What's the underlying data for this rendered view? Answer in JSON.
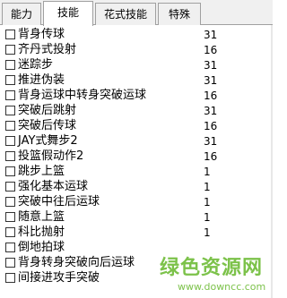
{
  "tabs": [
    {
      "label": "能力",
      "active": false
    },
    {
      "label": "技能",
      "active": true
    },
    {
      "label": "花式技能",
      "active": false
    },
    {
      "label": "特殊",
      "active": false
    }
  ],
  "skills": [
    {
      "name": "背身传球",
      "count": "31"
    },
    {
      "name": "齐丹式投射",
      "count": "16"
    },
    {
      "name": "迷踪步",
      "count": "31"
    },
    {
      "name": "推进伪装",
      "count": "31"
    },
    {
      "name": "背身运球中转身突破运球",
      "count": "16"
    },
    {
      "name": "突破后跳射",
      "count": "31"
    },
    {
      "name": "突破后传球",
      "count": "16"
    },
    {
      "name": "JAY式舞步2",
      "count": "31"
    },
    {
      "name": "投篮假动作2",
      "count": "16"
    },
    {
      "name": "跳步上篮",
      "count": "1"
    },
    {
      "name": "强化基本运球",
      "count": "1"
    },
    {
      "name": "突破中往后运球",
      "count": "1"
    },
    {
      "name": "随意上篮",
      "count": "1"
    },
    {
      "name": "科比抛射",
      "count": "1"
    },
    {
      "name": "倒地拍球",
      "count": ""
    },
    {
      "name": "背身转身突破向后运球",
      "count": ""
    },
    {
      "name": "间接进攻手突破",
      "count": ""
    }
  ],
  "watermark": {
    "main": "绿色资源网",
    "sub": "www.downcc.com",
    "color": "#7cc24a"
  }
}
